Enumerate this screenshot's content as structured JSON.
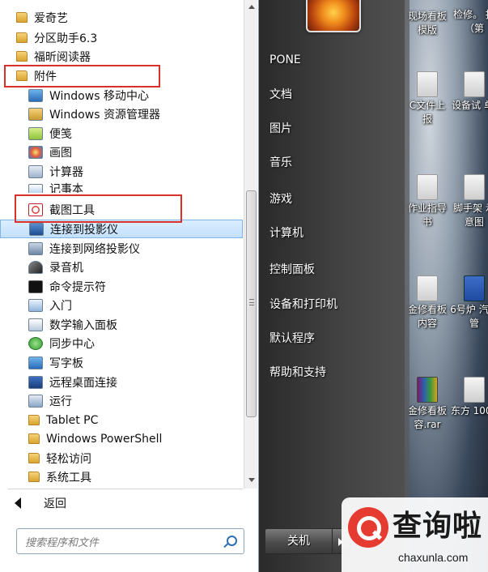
{
  "desktop": {
    "icons": [
      {
        "label": "现场看板 模版",
        "icon": "word-doc-icon"
      },
      {
        "label": "检修。 报（第",
        "icon": "doc-icon"
      },
      {
        "label": "C文件上 报",
        "icon": "doc-icon"
      },
      {
        "label": "设备试 单.",
        "icon": "doc-icon"
      },
      {
        "label": "作业指导 书",
        "icon": "doc-icon"
      },
      {
        "label": "脚手架 示意图",
        "icon": "doc-icon"
      },
      {
        "label": "金修看板 内容",
        "icon": "doc-icon"
      },
      {
        "label": "6号炉 汽母管",
        "icon": "word-doc-icon"
      },
      {
        "label": "金修看板 容.rar",
        "icon": "winrar-icon"
      },
      {
        "label": "东方 1000",
        "icon": "doc-icon"
      }
    ]
  },
  "start_menu": {
    "programs": [
      {
        "label": "爱奇艺",
        "type": "folder",
        "icon": "folder-icon"
      },
      {
        "label": "分区助手6.3",
        "type": "folder",
        "icon": "folder-icon"
      },
      {
        "label": "福昕阅读器",
        "type": "folder",
        "icon": "folder-icon"
      },
      {
        "label": "附件",
        "type": "folder",
        "icon": "folder-icon",
        "boxed": true
      },
      {
        "label": "Windows 移动中心",
        "type": "sub",
        "icon": "mobility-center-icon"
      },
      {
        "label": "Windows 资源管理器",
        "type": "sub",
        "icon": "explorer-icon"
      },
      {
        "label": "便笺",
        "type": "sub",
        "icon": "sticky-notes-icon"
      },
      {
        "label": "画图",
        "type": "sub",
        "icon": "paint-icon"
      },
      {
        "label": "计算器",
        "type": "sub",
        "icon": "calculator-icon"
      },
      {
        "label": "记事本",
        "type": "sub",
        "icon": "notepad-icon"
      },
      {
        "label": "截图工具",
        "type": "sub",
        "icon": "snipping-tool-icon",
        "boxed": true
      },
      {
        "label": "连接到投影仪",
        "type": "sub",
        "icon": "projector-icon",
        "highlighted": true
      },
      {
        "label": "连接到网络投影仪",
        "type": "sub",
        "icon": "network-projector-icon"
      },
      {
        "label": "录音机",
        "type": "sub",
        "icon": "microphone-icon"
      },
      {
        "label": "命令提示符",
        "type": "sub",
        "icon": "cmd-icon"
      },
      {
        "label": "入门",
        "type": "sub",
        "icon": "getting-started-icon"
      },
      {
        "label": "数学输入面板",
        "type": "sub",
        "icon": "math-input-icon"
      },
      {
        "label": "同步中心",
        "type": "sub",
        "icon": "sync-center-icon"
      },
      {
        "label": "写字板",
        "type": "sub",
        "icon": "wordpad-icon"
      },
      {
        "label": "远程桌面连接",
        "type": "sub",
        "icon": "remote-desktop-icon"
      },
      {
        "label": "运行",
        "type": "sub",
        "icon": "run-icon"
      },
      {
        "label": "Tablet PC",
        "type": "folder-sub",
        "icon": "folder-icon"
      },
      {
        "label": "Windows PowerShell",
        "type": "folder-sub",
        "icon": "folder-icon"
      },
      {
        "label": "轻松访问",
        "type": "folder-sub",
        "icon": "folder-icon"
      },
      {
        "label": "系统工具",
        "type": "folder-sub",
        "icon": "folder-icon"
      }
    ],
    "back_label": "返回",
    "search_placeholder": "搜索程序和文件",
    "right_items": [
      "PONE",
      "文档",
      "图片",
      "音乐",
      "游戏",
      "计算机",
      "控制面板",
      "设备和打印机",
      "默认程序",
      "帮助和支持"
    ],
    "shutdown_label": "关机"
  },
  "watermark": {
    "title": "查询啦",
    "url": "chaxunla.com"
  },
  "colors": {
    "highlight_bg": "#c3e0fb",
    "red_box": "#d9302b",
    "folder": "#e4b44a"
  }
}
